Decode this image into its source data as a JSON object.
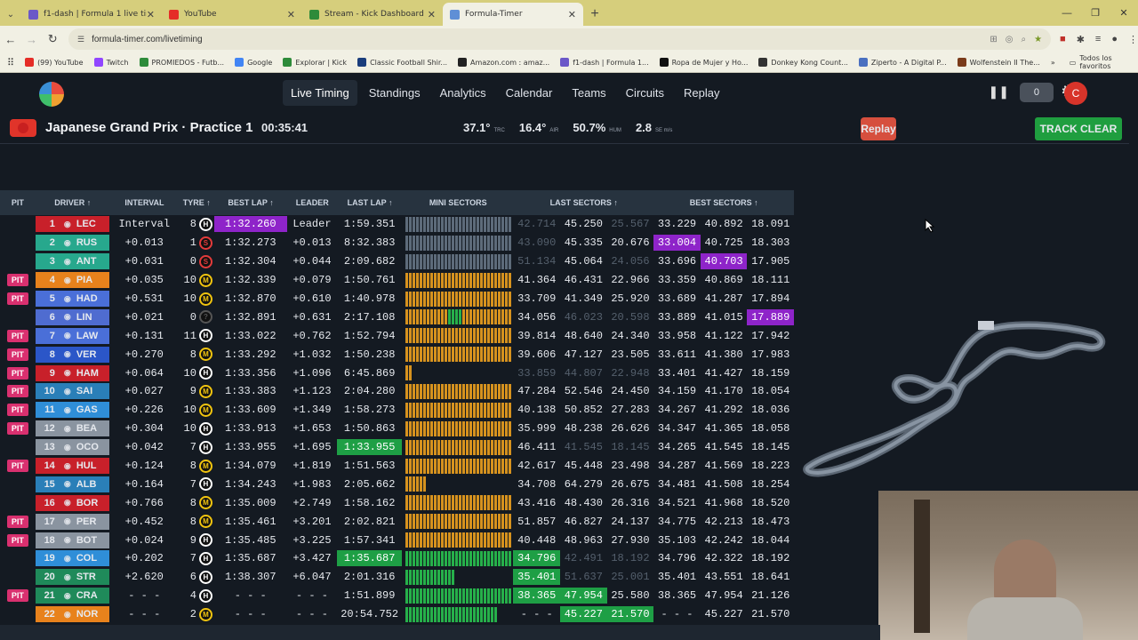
{
  "browser": {
    "tabs": [
      {
        "label": "f1-dash | Formula 1 live timing",
        "color": "#6b58c8",
        "active": false
      },
      {
        "label": "YouTube",
        "color": "#e52d27",
        "active": false
      },
      {
        "label": "Stream - Kick Dashboard",
        "color": "#2e8b3a",
        "active": false
      },
      {
        "label": "Formula-Timer",
        "color": "#5f8fd6",
        "active": true
      }
    ],
    "url": "formula-timer.com/livetiming",
    "bookmarks": [
      {
        "label": "(99) YouTube",
        "color": "#e52d27"
      },
      {
        "label": "Twitch",
        "color": "#9146ff"
      },
      {
        "label": "PROMIEDOS - Futb...",
        "color": "#2e8b3a"
      },
      {
        "label": "Google",
        "color": "#4285f4"
      },
      {
        "label": "Explorar | Kick",
        "color": "#2e8b3a"
      },
      {
        "label": "Classic Football Shir...",
        "color": "#1a3d7c"
      },
      {
        "label": "Amazon.com : amaz...",
        "color": "#222222"
      },
      {
        "label": "f1-dash | Formula 1...",
        "color": "#6b58c8"
      },
      {
        "label": "Ropa de Mujer y Ho...",
        "color": "#111111"
      },
      {
        "label": "Donkey Kong Count...",
        "color": "#333333"
      },
      {
        "label": "Ziperto - A Digital P...",
        "color": "#4a70c0"
      },
      {
        "label": "Wolfenstein II The...",
        "color": "#7a3b1a"
      }
    ],
    "all_bookmarks": "Todos los favoritos"
  },
  "nav": {
    "items": [
      "Live Timing",
      "Standings",
      "Analytics",
      "Calendar",
      "Teams",
      "Circuits",
      "Replay"
    ],
    "active": "Live Timing",
    "counter": "0",
    "avatar": "C"
  },
  "session": {
    "title": "Japanese Grand Prix · Practice 1",
    "remaining": "00:35:41",
    "weather": [
      {
        "value": "37.1°",
        "unit": "TRC"
      },
      {
        "value": "16.4°",
        "unit": "AIR"
      },
      {
        "value": "50.7%",
        "unit": "HUM"
      },
      {
        "value": "2.8",
        "unit": "SE m/s"
      }
    ],
    "replay_label": "Replay",
    "track_status": "TRACK CLEAR"
  },
  "columns": [
    "PIT",
    "DRIVER ↑",
    "INTERVAL",
    "TYRE ↑",
    "BEST LAP ↑",
    "LEADER",
    "LAST LAP ↑",
    "MINI SECTORS",
    "LAST SECTORS ↑",
    "BEST SECTORS ↑"
  ],
  "rows": [
    {
      "pit": "",
      "pos": "1",
      "code": "LEC",
      "team": "#c8202a",
      "interval": "Interval",
      "laps": "8",
      "tyre": "H",
      "tyreColor": "#ffffff",
      "best": "1:32.260",
      "bestStyle": "purple",
      "leader": "Leader",
      "last": "1:59.351",
      "lastStyle": "",
      "mini": "hhhhhhhhhhhhhhhhhhhhhhhhhhhhhh",
      "ls": [
        "42.714",
        "45.250",
        "25.567"
      ],
      "lsStyle": [
        "dim",
        "",
        "dim"
      ],
      "bs": [
        "33.229",
        "40.892",
        "18.091"
      ],
      "bsStyle": [
        "",
        "",
        ""
      ]
    },
    {
      "pit": "",
      "pos": "2",
      "code": "RUS",
      "team": "#27a88d",
      "interval": "+0.013",
      "laps": "1",
      "tyre": "S",
      "tyreColor": "#e33b3b",
      "best": "1:32.273",
      "bestStyle": "",
      "leader": "+0.013",
      "last": "8:32.383",
      "lastStyle": "",
      "mini": "hhhhhhhhhhhhhhhhhhhhhhhhhhhhhh",
      "ls": [
        "43.090",
        "45.335",
        "20.676"
      ],
      "lsStyle": [
        "dim",
        "",
        ""
      ],
      "bs": [
        "33.004",
        "40.725",
        "18.303"
      ],
      "bsStyle": [
        "purple",
        "",
        ""
      ]
    },
    {
      "pit": "",
      "pos": "3",
      "code": "ANT",
      "team": "#27a88d",
      "interval": "+0.031",
      "laps": "0",
      "tyre": "S",
      "tyreColor": "#e33b3b",
      "best": "1:32.304",
      "bestStyle": "",
      "leader": "+0.044",
      "last": "2:09.682",
      "lastStyle": "",
      "mini": "hhhhhhhhhhhhhhhhhhhhhhhhhhhhhh",
      "ls": [
        "51.134",
        "45.064",
        "24.056"
      ],
      "lsStyle": [
        "dim",
        "",
        "dim"
      ],
      "bs": [
        "33.696",
        "40.703",
        "17.905"
      ],
      "bsStyle": [
        "",
        "purple",
        ""
      ]
    },
    {
      "pit": "PIT",
      "pos": "4",
      "code": "PIA",
      "team": "#e8821c",
      "interval": "+0.035",
      "laps": "10",
      "tyre": "M",
      "tyreColor": "#f1c40f",
      "best": "1:32.339",
      "bestStyle": "",
      "leader": "+0.079",
      "last": "1:50.761",
      "lastStyle": "",
      "mini": "yyyyyyyyyyyyyyyyyyyyyyyyyyyyyy",
      "ls": [
        "41.364",
        "46.431",
        "22.966"
      ],
      "lsStyle": [
        "",
        "",
        ""
      ],
      "bs": [
        "33.359",
        "40.869",
        "18.111"
      ],
      "bsStyle": [
        "",
        "",
        ""
      ]
    },
    {
      "pit": "PIT",
      "pos": "5",
      "code": "HAD",
      "team": "#4a6fd8",
      "interval": "+0.531",
      "laps": "10",
      "tyre": "M",
      "tyreColor": "#f1c40f",
      "best": "1:32.870",
      "bestStyle": "",
      "leader": "+0.610",
      "last": "1:40.978",
      "lastStyle": "",
      "mini": "yyyyyyyyyyyyyyyyyyyyyyyyyyyyyy",
      "ls": [
        "33.709",
        "41.349",
        "25.920"
      ],
      "lsStyle": [
        "",
        "",
        ""
      ],
      "bs": [
        "33.689",
        "41.287",
        "17.894"
      ],
      "bsStyle": [
        "",
        "",
        ""
      ]
    },
    {
      "pit": "",
      "pos": "6",
      "code": "LIN",
      "team": "#4f6cd0",
      "interval": "+0.021",
      "laps": "0",
      "tyre": "?",
      "tyreColor": "#555555",
      "best": "1:32.891",
      "bestStyle": "",
      "leader": "+0.631",
      "last": "2:17.108",
      "lastStyle": "",
      "mini": "yyyyyyyyyyyyggggyyyyyyyyyyyyyy",
      "ls": [
        "34.056",
        "46.023",
        "20.598"
      ],
      "lsStyle": [
        "",
        "dim",
        "dim"
      ],
      "bs": [
        "33.889",
        "41.015",
        "17.889"
      ],
      "bsStyle": [
        "",
        "",
        "purple"
      ]
    },
    {
      "pit": "PIT",
      "pos": "7",
      "code": "LAW",
      "team": "#4a6fd8",
      "interval": "+0.131",
      "laps": "11",
      "tyre": "H",
      "tyreColor": "#ffffff",
      "best": "1:33.022",
      "bestStyle": "",
      "leader": "+0.762",
      "last": "1:52.794",
      "lastStyle": "",
      "mini": "yyyyyyyyyyyyyyyyyyyyyyyyyyyyyy",
      "ls": [
        "39.814",
        "48.640",
        "24.340"
      ],
      "lsStyle": [
        "",
        "",
        ""
      ],
      "bs": [
        "33.958",
        "41.122",
        "17.942"
      ],
      "bsStyle": [
        "",
        "",
        ""
      ]
    },
    {
      "pit": "PIT",
      "pos": "8",
      "code": "VER",
      "team": "#2b56c8",
      "interval": "+0.270",
      "laps": "8",
      "tyre": "M",
      "tyreColor": "#f1c40f",
      "best": "1:33.292",
      "bestStyle": "",
      "leader": "+1.032",
      "last": "1:50.238",
      "lastStyle": "",
      "mini": "yyyyyyyyyyyyyyyyyyyyyyyyyyyyyy",
      "ls": [
        "39.606",
        "47.127",
        "23.505"
      ],
      "lsStyle": [
        "",
        "",
        ""
      ],
      "bs": [
        "33.611",
        "41.380",
        "17.983"
      ],
      "bsStyle": [
        "",
        "",
        ""
      ]
    },
    {
      "pit": "PIT",
      "pos": "9",
      "code": "HAM",
      "team": "#c8202a",
      "interval": "+0.064",
      "laps": "10",
      "tyre": "H",
      "tyreColor": "#ffffff",
      "best": "1:33.356",
      "bestStyle": "",
      "leader": "+1.096",
      "last": "6:45.869",
      "lastStyle": "",
      "mini": "yy",
      "ls": [
        "33.859",
        "44.807",
        "22.948"
      ],
      "lsStyle": [
        "dim",
        "dim",
        "dim"
      ],
      "bs": [
        "33.401",
        "41.427",
        "18.159"
      ],
      "bsStyle": [
        "",
        "",
        ""
      ]
    },
    {
      "pit": "PIT",
      "pos": "10",
      "code": "SAI",
      "team": "#2a7fb8",
      "interval": "+0.027",
      "laps": "9",
      "tyre": "M",
      "tyreColor": "#f1c40f",
      "best": "1:33.383",
      "bestStyle": "",
      "leader": "+1.123",
      "last": "2:04.280",
      "lastStyle": "",
      "mini": "yyyyyyyyyyyyyyyyyyyyyyyyyyyyyy",
      "ls": [
        "47.284",
        "52.546",
        "24.450"
      ],
      "lsStyle": [
        "",
        "",
        ""
      ],
      "bs": [
        "34.159",
        "41.170",
        "18.054"
      ],
      "bsStyle": [
        "",
        "",
        ""
      ]
    },
    {
      "pit": "PIT",
      "pos": "11",
      "code": "GAS",
      "team": "#2f8ed8",
      "interval": "+0.226",
      "laps": "10",
      "tyre": "M",
      "tyreColor": "#f1c40f",
      "best": "1:33.609",
      "bestStyle": "",
      "leader": "+1.349",
      "last": "1:58.273",
      "lastStyle": "",
      "mini": "yyyyyyyyyyyyyyyyyyyyyyyyyyyyyy",
      "ls": [
        "40.138",
        "50.852",
        "27.283"
      ],
      "lsStyle": [
        "",
        "",
        ""
      ],
      "bs": [
        "34.267",
        "41.292",
        "18.036"
      ],
      "bsStyle": [
        "",
        "",
        ""
      ]
    },
    {
      "pit": "PIT",
      "pos": "12",
      "code": "BEA",
      "team": "#8a94a0",
      "interval": "+0.304",
      "laps": "10",
      "tyre": "H",
      "tyreColor": "#ffffff",
      "best": "1:33.913",
      "bestStyle": "",
      "leader": "+1.653",
      "last": "1:50.863",
      "lastStyle": "",
      "mini": "yyyyyyyyyyyyyyyyyyyyyyyyyyyyyy",
      "ls": [
        "35.999",
        "48.238",
        "26.626"
      ],
      "lsStyle": [
        "",
        "",
        ""
      ],
      "bs": [
        "34.347",
        "41.365",
        "18.058"
      ],
      "bsStyle": [
        "",
        "",
        ""
      ]
    },
    {
      "pit": "",
      "pos": "13",
      "code": "OCO",
      "team": "#8a94a0",
      "interval": "+0.042",
      "laps": "7",
      "tyre": "H",
      "tyreColor": "#ffffff",
      "best": "1:33.955",
      "bestStyle": "",
      "leader": "+1.695",
      "last": "1:33.955",
      "lastStyle": "green",
      "mini": "yyyyyyyyyyyyyyyyyyyyyyyyyyyyyy",
      "ls": [
        "46.411",
        "41.545",
        "18.145"
      ],
      "lsStyle": [
        "",
        "dim",
        "dim"
      ],
      "bs": [
        "34.265",
        "41.545",
        "18.145"
      ],
      "bsStyle": [
        "",
        "",
        ""
      ]
    },
    {
      "pit": "PIT",
      "pos": "14",
      "code": "HUL",
      "team": "#c8202a",
      "interval": "+0.124",
      "laps": "8",
      "tyre": "M",
      "tyreColor": "#f1c40f",
      "best": "1:34.079",
      "bestStyle": "",
      "leader": "+1.819",
      "last": "1:51.563",
      "lastStyle": "",
      "mini": "yyyyyyyyyyyyyyyyyyyyyyyyyyyyyy",
      "ls": [
        "42.617",
        "45.448",
        "23.498"
      ],
      "lsStyle": [
        "",
        "",
        ""
      ],
      "bs": [
        "34.287",
        "41.569",
        "18.223"
      ],
      "bsStyle": [
        "",
        "",
        ""
      ]
    },
    {
      "pit": "",
      "pos": "15",
      "code": "ALB",
      "team": "#2a7fb8",
      "interval": "+0.164",
      "laps": "7",
      "tyre": "H",
      "tyreColor": "#ffffff",
      "best": "1:34.243",
      "bestStyle": "",
      "leader": "+1.983",
      "last": "2:05.662",
      "lastStyle": "",
      "mini": "yyyyyy",
      "ls": [
        "34.708",
        "64.279",
        "26.675"
      ],
      "lsStyle": [
        "",
        "",
        ""
      ],
      "bs": [
        "34.481",
        "41.508",
        "18.254"
      ],
      "bsStyle": [
        "",
        "",
        ""
      ]
    },
    {
      "pit": "",
      "pos": "16",
      "code": "BOR",
      "team": "#c8202a",
      "interval": "+0.766",
      "laps": "8",
      "tyre": "M",
      "tyreColor": "#f1c40f",
      "best": "1:35.009",
      "bestStyle": "",
      "leader": "+2.749",
      "last": "1:58.162",
      "lastStyle": "",
      "mini": "yyyyyyyyyyyyyyyyyyyyyyyyyyyyyy",
      "ls": [
        "43.416",
        "48.430",
        "26.316"
      ],
      "lsStyle": [
        "",
        "",
        ""
      ],
      "bs": [
        "34.521",
        "41.968",
        "18.520"
      ],
      "bsStyle": [
        "",
        "",
        ""
      ]
    },
    {
      "pit": "PIT",
      "pos": "17",
      "code": "PER",
      "team": "#8a94a0",
      "interval": "+0.452",
      "laps": "8",
      "tyre": "M",
      "tyreColor": "#f1c40f",
      "best": "1:35.461",
      "bestStyle": "",
      "leader": "+3.201",
      "last": "2:02.821",
      "lastStyle": "",
      "mini": "yyyyyyyyyyyyyyyyyyyyyyyyyyyyyy",
      "ls": [
        "51.857",
        "46.827",
        "24.137"
      ],
      "lsStyle": [
        "",
        "",
        ""
      ],
      "bs": [
        "34.775",
        "42.213",
        "18.473"
      ],
      "bsStyle": [
        "",
        "",
        ""
      ]
    },
    {
      "pit": "PIT",
      "pos": "18",
      "code": "BOT",
      "team": "#8a94a0",
      "interval": "+0.024",
      "laps": "9",
      "tyre": "H",
      "tyreColor": "#ffffff",
      "best": "1:35.485",
      "bestStyle": "",
      "leader": "+3.225",
      "last": "1:57.341",
      "lastStyle": "",
      "mini": "yyyyyyyyyyyyyyyyyyyyyyyyyyyyyy",
      "ls": [
        "40.448",
        "48.963",
        "27.930"
      ],
      "lsStyle": [
        "",
        "",
        ""
      ],
      "bs": [
        "35.103",
        "42.242",
        "18.044"
      ],
      "bsStyle": [
        "",
        "",
        ""
      ]
    },
    {
      "pit": "",
      "pos": "19",
      "code": "COL",
      "team": "#2f8ed8",
      "interval": "+0.202",
      "laps": "7",
      "tyre": "H",
      "tyreColor": "#ffffff",
      "best": "1:35.687",
      "bestStyle": "",
      "leader": "+3.427",
      "last": "1:35.687",
      "lastStyle": "green",
      "mini": "gggggggggggggggggggggggggggggg",
      "ls": [
        "34.796",
        "42.491",
        "18.192"
      ],
      "lsStyle": [
        "green",
        "dim",
        "dim"
      ],
      "bs": [
        "34.796",
        "42.322",
        "18.192"
      ],
      "bsStyle": [
        "",
        "",
        ""
      ]
    },
    {
      "pit": "",
      "pos": "20",
      "code": "STR",
      "team": "#1f8a5a",
      "interval": "+2.620",
      "laps": "6",
      "tyre": "H",
      "tyreColor": "#ffffff",
      "best": "1:38.307",
      "bestStyle": "",
      "leader": "+6.047",
      "last": "2:01.316",
      "lastStyle": "",
      "mini": "gggggggggggggg",
      "ls": [
        "35.401",
        "51.637",
        "25.001"
      ],
      "lsStyle": [
        "green",
        "dim",
        "dim"
      ],
      "bs": [
        "35.401",
        "43.551",
        "18.641"
      ],
      "bsStyle": [
        "",
        "",
        ""
      ]
    },
    {
      "pit": "PIT",
      "pos": "21",
      "code": "CRA",
      "team": "#1f8a5a",
      "interval": "- - -",
      "laps": "4",
      "tyre": "H",
      "tyreColor": "#ffffff",
      "best": "- - -",
      "bestStyle": "",
      "leader": "- - -",
      "last": "1:51.899",
      "lastStyle": "",
      "mini": "gggggggggggggggggggggggggggggg",
      "ls": [
        "38.365",
        "47.954",
        "25.580"
      ],
      "lsStyle": [
        "green",
        "green",
        ""
      ],
      "bs": [
        "38.365",
        "47.954",
        "21.126"
      ],
      "bsStyle": [
        "",
        "",
        ""
      ]
    },
    {
      "pit": "",
      "pos": "22",
      "code": "NOR",
      "team": "#e8821c",
      "interval": "- - -",
      "laps": "2",
      "tyre": "M",
      "tyreColor": "#f1c40f",
      "best": "- - -",
      "bestStyle": "",
      "leader": "- - -",
      "last": "20:54.752",
      "lastStyle": "",
      "mini": "gggggggggggggggggggggggggg",
      "ls": [
        "- - -",
        "45.227",
        "21.570"
      ],
      "lsStyle": [
        "",
        "green",
        "green"
      ],
      "bs": [
        "- - -",
        "45.227",
        "21.570"
      ],
      "bsStyle": [
        "",
        "",
        ""
      ]
    }
  ]
}
